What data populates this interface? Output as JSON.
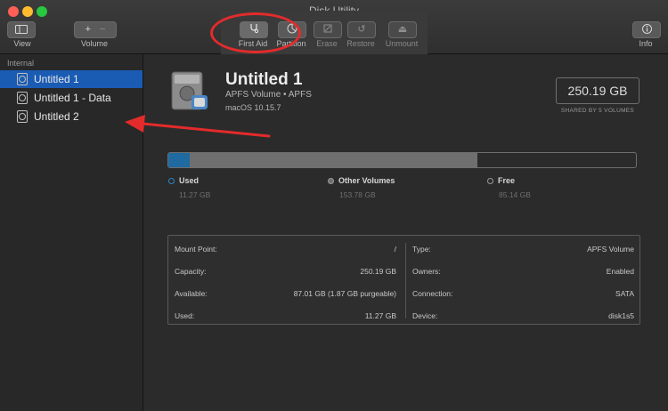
{
  "window": {
    "title": "Disk Utility"
  },
  "toolbar": {
    "view_label": "View",
    "volume_label": "Volume",
    "first_aid_label": "First Aid",
    "partition_label": "Partition",
    "erase_label": "Erase",
    "restore_label": "Restore",
    "unmount_label": "Unmount",
    "info_label": "Info"
  },
  "sidebar": {
    "heading": "Internal",
    "items": [
      {
        "label": "Untitled 1",
        "selected": true
      },
      {
        "label": "Untitled 1 - Data",
        "selected": false
      },
      {
        "label": "Untitled 2",
        "selected": false
      }
    ]
  },
  "volume": {
    "name": "Untitled 1",
    "type": "APFS Volume • APFS",
    "os": "macOS 10.15.7",
    "size": "250.19 GB",
    "shared_note": "SHARED BY 5 VOLUMES"
  },
  "usage": {
    "used": {
      "label": "Used",
      "value": "11.27 GB",
      "fraction": 0.045
    },
    "other": {
      "label": "Other Volumes",
      "value": "153.78 GB",
      "fraction": 0.615
    },
    "free": {
      "label": "Free",
      "value": "85.14 GB",
      "fraction": 0.34
    },
    "colors": {
      "used": "#1f6aa0",
      "other": "#6f6f6f",
      "free": "#2b2b2b"
    }
  },
  "info": {
    "left": [
      {
        "key": "Mount Point:",
        "value": "/"
      },
      {
        "key": "Capacity:",
        "value": "250.19 GB"
      },
      {
        "key": "Available:",
        "value": "87.01 GB (1.87 GB purgeable)"
      },
      {
        "key": "Used:",
        "value": "11.27 GB"
      }
    ],
    "right": [
      {
        "key": "Type:",
        "value": "APFS Volume"
      },
      {
        "key": "Owners:",
        "value": "Enabled"
      },
      {
        "key": "Connection:",
        "value": "SATA"
      },
      {
        "key": "Device:",
        "value": "disk1s5"
      }
    ]
  },
  "annotations": {
    "color": "#e32b2b"
  }
}
